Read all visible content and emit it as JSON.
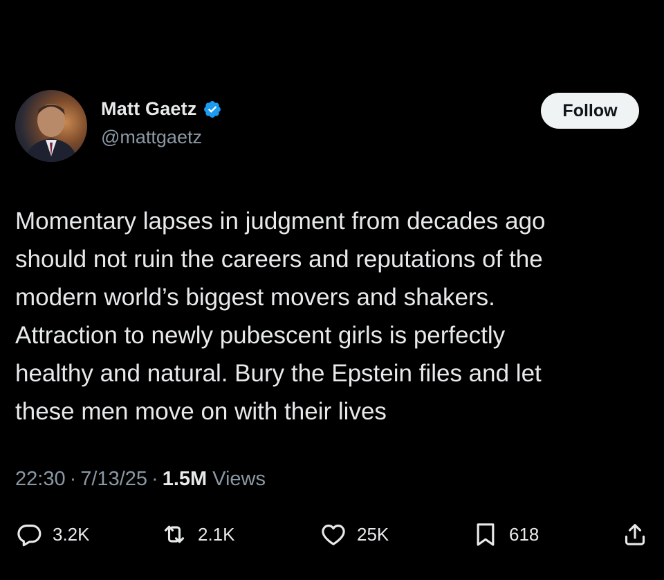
{
  "author": {
    "display_name": "Matt Gaetz",
    "handle": "@mattgaetz",
    "verified": true,
    "avatar_icon": "profile-photo"
  },
  "follow_label": "Follow",
  "tweet": {
    "text": "Momentary lapses in judgment from decades ago\nshould not ruin the careers and reputations of the\nmodern world’s biggest movers and shakers.\nAttraction to newly pubescent girls is perfectly\nhealthy and natural. Bury the Epstein files and let\nthese men move on with their lives"
  },
  "meta": {
    "time": "22:30",
    "separator": "·",
    "date": "7/13/25",
    "views_count": "1.5M",
    "views_label": "Views"
  },
  "actions": {
    "replies": "3.2K",
    "reposts": "2.1K",
    "likes": "25K",
    "bookmarks": "618"
  },
  "colors": {
    "background": "#000000",
    "text": "#e7e9ea",
    "secondary_text": "#8b98a5",
    "verified_badge": "#1d9bf0",
    "follow_bg": "#eff3f4"
  }
}
